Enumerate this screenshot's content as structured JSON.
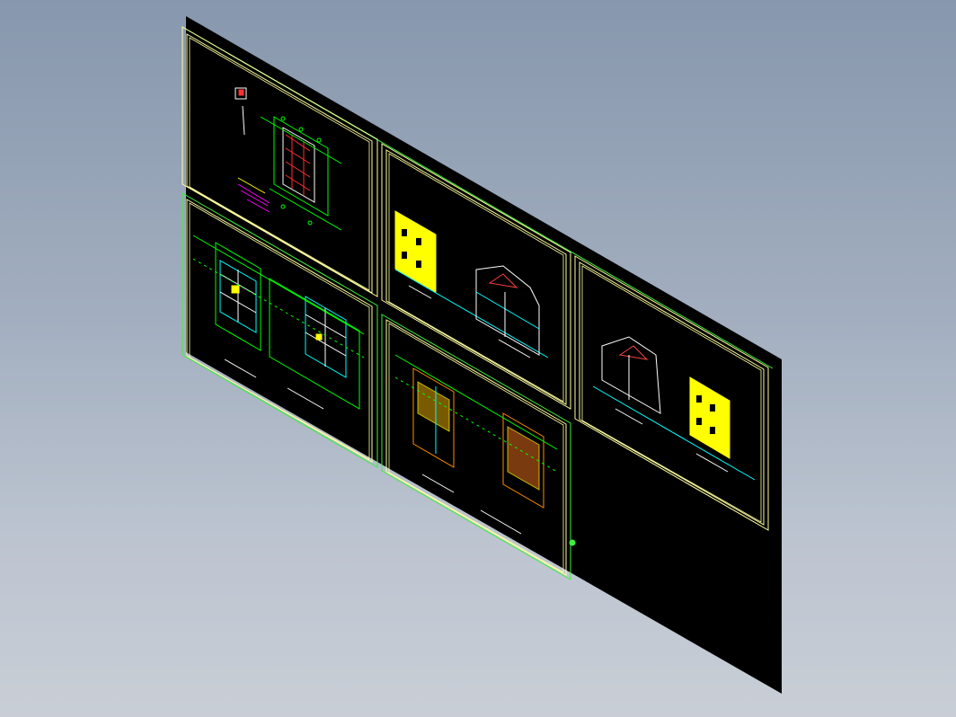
{
  "scene": {
    "background_top": "#8797ad",
    "background_bottom": "#c9ced6",
    "plane_color": "#000000",
    "frame_color": "#ffffa0",
    "edge_color": "#3cf03c",
    "selection_dot": "#3cf03c"
  },
  "sheets": [
    {
      "id": "sheet-1",
      "content": "site-plan",
      "dominant_colors": [
        "#00ff00",
        "#ff3030",
        "#ffffff",
        "#ff00ff"
      ]
    },
    {
      "id": "sheet-2",
      "content": "floor-plans",
      "dominant_colors": [
        "#00ff00",
        "#ffffff",
        "#00ffff",
        "#ffff00"
      ]
    },
    {
      "id": "sheet-3",
      "content": "elevation-and-section",
      "dominant_colors": [
        "#ffff00",
        "#00ffff",
        "#ffffff",
        "#ff4040"
      ]
    },
    {
      "id": "sheet-4",
      "content": "roof-plans",
      "dominant_colors": [
        "#00ff00",
        "#ff8c00",
        "#ffff00",
        "#ffffff"
      ]
    },
    {
      "id": "sheet-5",
      "content": "section-and-elevation",
      "dominant_colors": [
        "#ffff00",
        "#00ffff",
        "#ffffff",
        "#ff4040"
      ]
    }
  ]
}
